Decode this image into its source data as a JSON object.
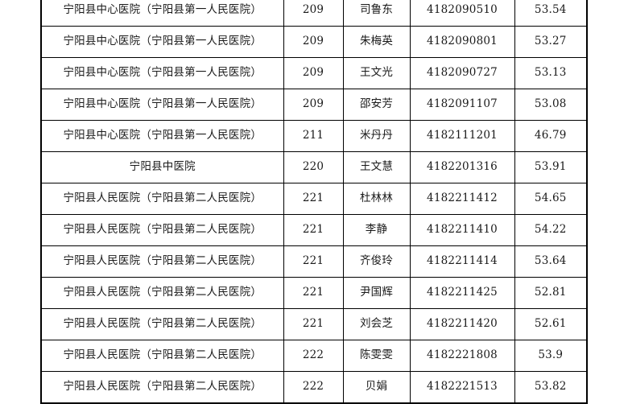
{
  "table": {
    "columns": [
      {
        "key": "org",
        "name": "organization-column"
      },
      {
        "key": "code",
        "name": "position-code-column"
      },
      {
        "key": "name",
        "name": "candidate-name-column"
      },
      {
        "key": "id",
        "name": "exam-number-column"
      },
      {
        "key": "score",
        "name": "score-column"
      }
    ],
    "rows": [
      {
        "org": "宁阳县中心医院（宁阳县第一人民医院）",
        "code": "209",
        "name": "司鲁东",
        "id": "4182090510",
        "score": "53.54"
      },
      {
        "org": "宁阳县中心医院（宁阳县第一人民医院）",
        "code": "209",
        "name": "朱梅英",
        "id": "4182090801",
        "score": "53.27"
      },
      {
        "org": "宁阳县中心医院（宁阳县第一人民医院）",
        "code": "209",
        "name": "王文光",
        "id": "4182090727",
        "score": "53.13"
      },
      {
        "org": "宁阳县中心医院（宁阳县第一人民医院）",
        "code": "209",
        "name": "邵安芳",
        "id": "4182091107",
        "score": "53.08"
      },
      {
        "org": "宁阳县中心医院（宁阳县第一人民医院）",
        "code": "211",
        "name": "米丹丹",
        "id": "4182111201",
        "score": "46.79"
      },
      {
        "org": "宁阳县中医院",
        "code": "220",
        "name": "王文慧",
        "id": "4182201316",
        "score": "53.91"
      },
      {
        "org": "宁阳县人民医院（宁阳县第二人民医院）",
        "code": "221",
        "name": "杜林林",
        "id": "4182211412",
        "score": "54.65"
      },
      {
        "org": "宁阳县人民医院（宁阳县第二人民医院）",
        "code": "221",
        "name": "李静",
        "id": "4182211410",
        "score": "54.22"
      },
      {
        "org": "宁阳县人民医院（宁阳县第二人民医院）",
        "code": "221",
        "name": "齐俊玲",
        "id": "4182211414",
        "score": "53.64"
      },
      {
        "org": "宁阳县人民医院（宁阳县第二人民医院）",
        "code": "221",
        "name": "尹国辉",
        "id": "4182211425",
        "score": "52.81"
      },
      {
        "org": "宁阳县人民医院（宁阳县第二人民医院）",
        "code": "221",
        "name": "刘会芝",
        "id": "4182211420",
        "score": "52.61"
      },
      {
        "org": "宁阳县人民医院（宁阳县第二人民医院）",
        "code": "222",
        "name": "陈雯雯",
        "id": "4182221808",
        "score": "53.9"
      },
      {
        "org": "宁阳县人民医院（宁阳县第二人民医院）",
        "code": "222",
        "name": "贝娟",
        "id": "4182221513",
        "score": "53.82"
      }
    ]
  },
  "colors": {
    "border": "#000000",
    "text": "#1a1a1a",
    "background": "#ffffff"
  }
}
